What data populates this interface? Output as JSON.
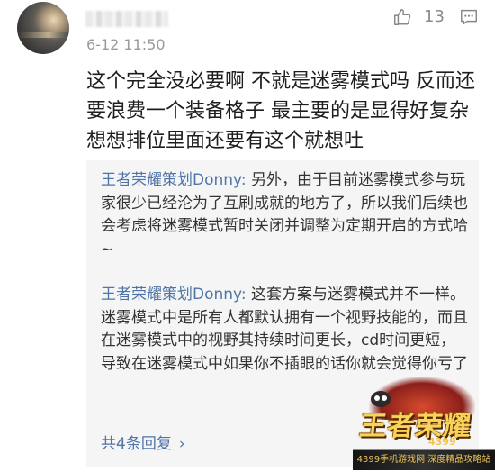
{
  "post": {
    "timestamp": "6-12 11:50",
    "like_count": "13",
    "text": "这个完全没必要啊 不就是迷雾模式吗 反而还要浪费一个装备格子 最主要的是显得好复杂 想想排位里面还要有这个就想吐"
  },
  "replies": [
    {
      "author": "王者荣耀策划Donny",
      "separator": ": ",
      "text": "另外，由于目前迷雾模式参与玩家很少已经沦为了互刷成就的地方了，所以我们后续也会考虑将迷雾模式暂时关闭并调整为定期开启的方式哈~"
    },
    {
      "author": "王者荣耀策划Donny",
      "separator": ": ",
      "text": "这套方案与迷雾模式并不一样。迷雾模式中是所有人都默认拥有一个视野技能的，而且在迷雾模式中的视野其持续时间更长，cd时间更短，导致在迷雾模式中如果你不插眼的话你就会觉得你亏了"
    }
  ],
  "more_replies": {
    "label": "共4条回复",
    "chevron": "›"
  },
  "watermark": {
    "title": "王者荣耀",
    "sub": "4399",
    "band": "4399手机游戏网  深度精品攻略站"
  },
  "icons": {
    "like": "thumbs-up-icon",
    "comment": "comment-icon",
    "chevron": "chevron-right-icon"
  },
  "colors": {
    "author_link": "#4f74a8",
    "reply_bg": "#f5f5f5",
    "meta_gray": "#9a9a9a"
  }
}
